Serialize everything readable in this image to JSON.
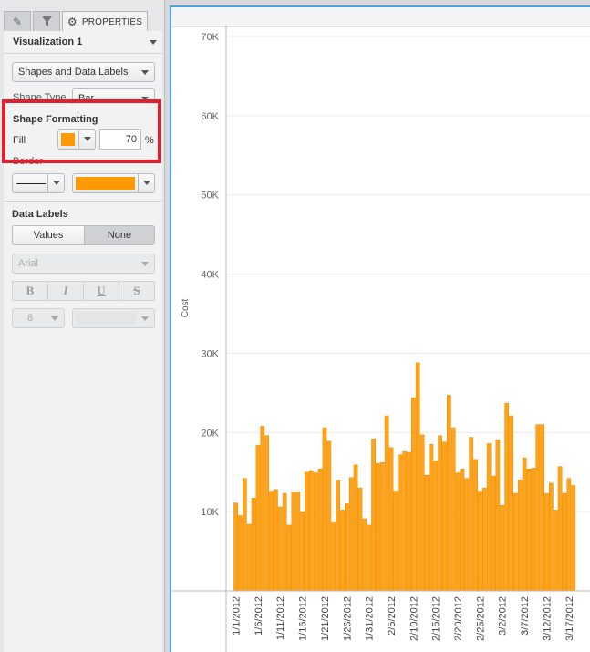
{
  "panel": {
    "tabs": [
      {
        "name": "edit",
        "icon": "pencil-icon"
      },
      {
        "name": "filter",
        "icon": "filter-icon"
      },
      {
        "name": "properties",
        "icon": "gear-icon",
        "label": "PROPERTIES"
      }
    ],
    "visualization_title": "Visualization 1",
    "section_dropdown": "Shapes and Data Labels",
    "shape_type": {
      "label": "Shape Type",
      "value": "Bar"
    },
    "shape_formatting": {
      "heading": "Shape Formatting",
      "fill_label": "Fill",
      "fill_color": "#ff9a00",
      "opacity_value": "70",
      "opacity_unit": "%"
    },
    "border": {
      "label": "Border",
      "color": "#ff9a00"
    },
    "data_labels": {
      "heading": "Data Labels",
      "values_button": "Values",
      "none_button": "None",
      "font": "Arial",
      "bold": "B",
      "italic": "I",
      "underline": "U",
      "strike": "S",
      "size": "8"
    }
  },
  "chart_data": {
    "type": "bar",
    "ylabel": "Cost",
    "ylim": [
      0,
      70000
    ],
    "y_ticks": [
      "10K",
      "20K",
      "30K",
      "40K",
      "50K",
      "60K",
      "70K"
    ],
    "x_tick_labels": [
      "1/1/2012",
      "1/6/2012",
      "1/11/2012",
      "1/16/2012",
      "1/21/2012",
      "1/26/2012",
      "1/31/2012",
      "2/5/2012",
      "2/10/2012",
      "2/15/2012",
      "2/20/2012",
      "2/25/2012",
      "3/2/2012",
      "3/7/2012",
      "3/12/2012",
      "3/17/2012"
    ],
    "bar_color": "#ffa31a",
    "values": [
      11100,
      9500,
      14200,
      8400,
      11700,
      18400,
      20800,
      19600,
      12600,
      12800,
      10600,
      12300,
      8300,
      12500,
      12500,
      10000,
      15000,
      15200,
      14900,
      15400,
      20600,
      18900,
      8700,
      14000,
      10200,
      11000,
      14300,
      15900,
      13000,
      9100,
      8300,
      19200,
      16100,
      16200,
      22100,
      18100,
      12600,
      17200,
      17600,
      17500,
      24400,
      28800,
      19700,
      14600,
      18500,
      16400,
      19600,
      18800,
      24700,
      20600,
      14900,
      15400,
      14200,
      19400,
      16600,
      12600,
      13000,
      18600,
      14500,
      19100,
      10800,
      23700,
      22100,
      12300,
      14000,
      16800,
      15400,
      15500,
      21000,
      21000,
      12300,
      13600,
      10200,
      15700,
      12300,
      14200,
      13300
    ]
  }
}
